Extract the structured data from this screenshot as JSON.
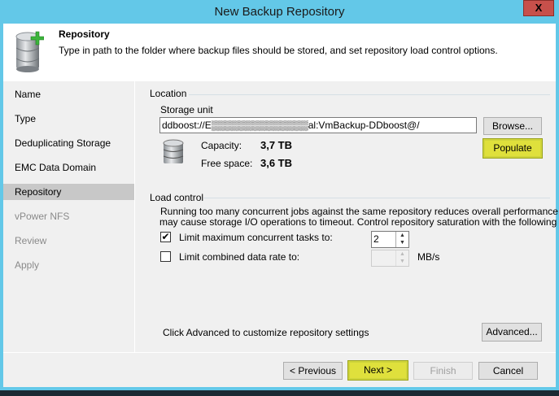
{
  "window": {
    "title": "New Backup Repository",
    "close_label": "X"
  },
  "header": {
    "title": "Repository",
    "description": "Type in path to the folder where backup files should be stored, and set repository load control options."
  },
  "nav": {
    "items": [
      {
        "label": "Name",
        "state": "normal"
      },
      {
        "label": "Type",
        "state": "normal"
      },
      {
        "label": "Deduplicating Storage",
        "state": "normal"
      },
      {
        "label": "EMC Data Domain",
        "state": "normal"
      },
      {
        "label": "Repository",
        "state": "selected"
      },
      {
        "label": "vPower NFS",
        "state": "disabled"
      },
      {
        "label": "Review",
        "state": "disabled"
      },
      {
        "label": "Apply",
        "state": "disabled"
      }
    ]
  },
  "location": {
    "group_label": "Location",
    "storage_unit_label": "Storage unit",
    "storage_unit_value": "ddboost://E▒▒▒▒▒▒▒▒▒▒▒▒▒▒al:VmBackup-DDboost@/",
    "browse_label": "Browse...",
    "populate_label": "Populate",
    "capacity_label": "Capacity:",
    "capacity_value": "3,7 TB",
    "free_label": "Free space:",
    "free_value": "3,6 TB"
  },
  "load_control": {
    "group_label": "Load control",
    "description_1": "Running too many concurrent jobs against the same repository reduces overall performance, and",
    "description_2": "may cause storage I/O operations to timeout. Control repository saturation with the following",
    "limit_tasks_label": "Limit maximum concurrent tasks to:",
    "limit_tasks_checked": true,
    "limit_tasks_value": "2",
    "limit_rate_label": "Limit combined data rate to:",
    "limit_rate_checked": false,
    "limit_rate_value": "",
    "rate_unit": "MB/s"
  },
  "advanced": {
    "hint": "Click Advanced to customize repository settings",
    "button_label": "Advanced..."
  },
  "footer": {
    "previous_label": "< Previous",
    "next_label": "Next >",
    "finish_label": "Finish",
    "cancel_label": "Cancel"
  },
  "colors": {
    "title_bar": "#63c8e8",
    "highlight": "#dfe03c",
    "close": "#c7504b"
  }
}
